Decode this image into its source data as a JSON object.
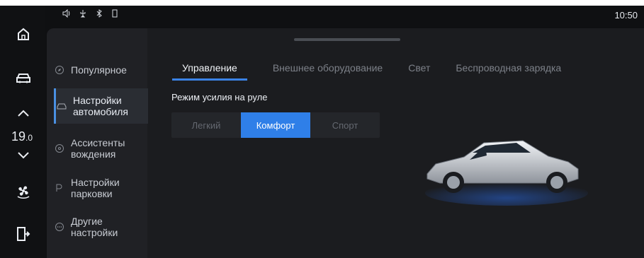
{
  "status": {
    "time": "10:50"
  },
  "rail": {
    "temperature_main": "19",
    "temperature_decimal": ".0"
  },
  "sidebar": {
    "items": [
      {
        "label": "Популярное"
      },
      {
        "label": "Настройки\nавтомобиля"
      },
      {
        "label": "Ассистенты\nвождения"
      },
      {
        "label": "Настройки\nпарковки"
      },
      {
        "label": "Другие\nнастройки"
      }
    ]
  },
  "tabs": [
    {
      "label": "Управление"
    },
    {
      "label": "Внешнее оборудование"
    },
    {
      "label": "Свет"
    },
    {
      "label": "Беспроводная зарядка"
    }
  ],
  "steering": {
    "title": "Режим усилия на руле",
    "options": [
      "Легкий",
      "Комфорт",
      "Спорт"
    ],
    "selected": "Комфорт"
  },
  "colors": {
    "accent": "#2f7fe8",
    "background": "#0f1012",
    "panel": "#1b1c1f"
  },
  "icons": [
    "home-icon",
    "car-icon",
    "chevron-up-icon",
    "chevron-down-icon",
    "fan-icon",
    "door-exit-icon",
    "speaker-icon",
    "usb-icon",
    "bluetooth-icon",
    "battery-icon"
  ]
}
